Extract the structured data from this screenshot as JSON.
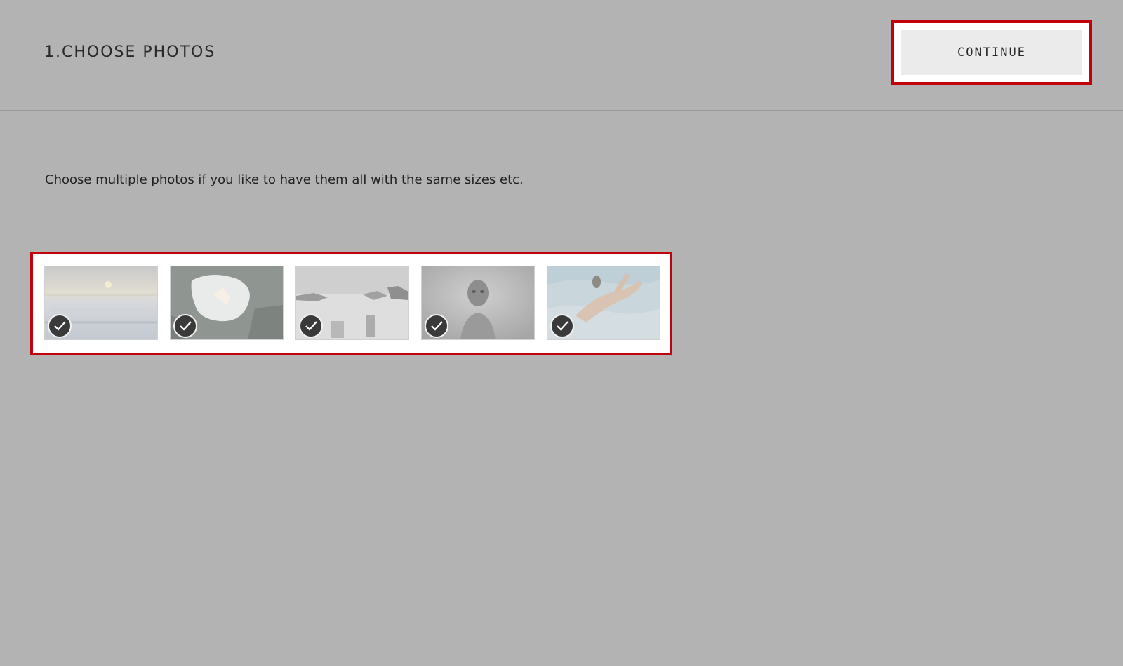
{
  "header": {
    "title": "1.CHOOSE PHOTOS",
    "continue_label": "CONTINUE"
  },
  "main": {
    "instructions": "Choose multiple photos if you like to have them all with the same sizes etc."
  },
  "photos": [
    {
      "subject": "sunset-over-sea",
      "selected": true,
      "check_icon": "checkmark-icon"
    },
    {
      "subject": "woman-in-water-among-rocks",
      "selected": true,
      "check_icon": "checkmark-icon"
    },
    {
      "subject": "beach-with-rocks-and-figures",
      "selected": true,
      "check_icon": "checkmark-icon"
    },
    {
      "subject": "portrait-of-woman",
      "selected": true,
      "check_icon": "checkmark-icon"
    },
    {
      "subject": "woman-floating-underwater",
      "selected": true,
      "check_icon": "checkmark-icon"
    }
  ],
  "colors": {
    "highlight": "#c0000b",
    "overlay": "#b3b3b3",
    "button_bg": "#ebebeb",
    "check_bg": "#3a3a3a"
  }
}
